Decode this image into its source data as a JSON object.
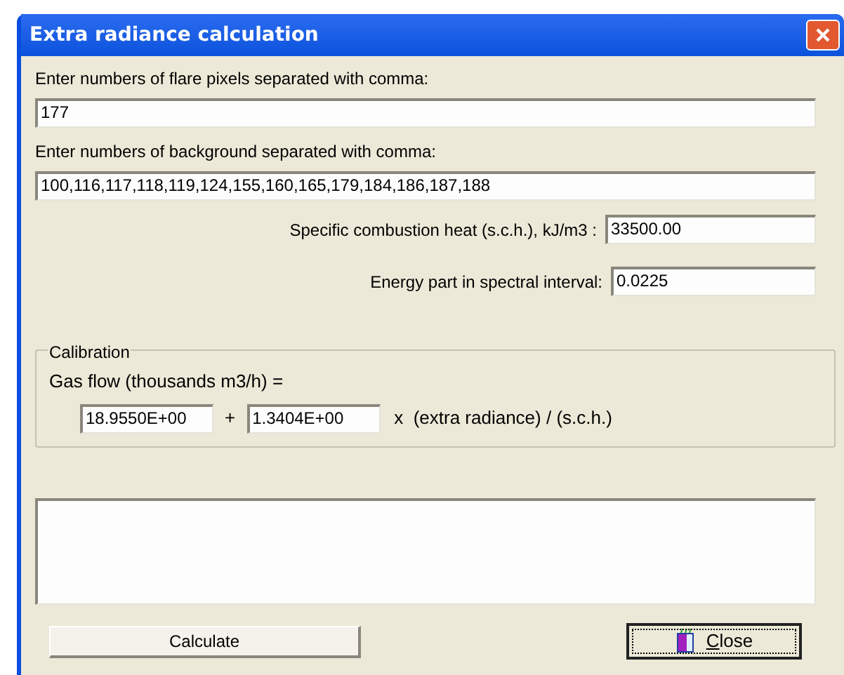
{
  "window": {
    "title": "Extra radiance calculation"
  },
  "flare": {
    "label": "Enter numbers of flare pixels separated with comma:",
    "value": "177"
  },
  "background": {
    "label": "Enter numbers of background separated with comma:",
    "value": "100,116,117,118,119,124,155,160,165,179,184,186,187,188"
  },
  "sch": {
    "label": "Specific combustion heat (s.c.h.), kJ/m3 :",
    "value": "33500.00"
  },
  "energy": {
    "label": "Energy part in spectral interval:",
    "value": "0.0225"
  },
  "calibration": {
    "title": "Calibration",
    "formula_label": "Gas flow (thousands m3/h) =",
    "intercept": "18.9550E+00",
    "plus": "+",
    "slope": "1.3404E+00",
    "suffix": "x  (extra radiance) / (s.c.h.)"
  },
  "buttons": {
    "calculate": "Calculate",
    "close": "Close"
  }
}
